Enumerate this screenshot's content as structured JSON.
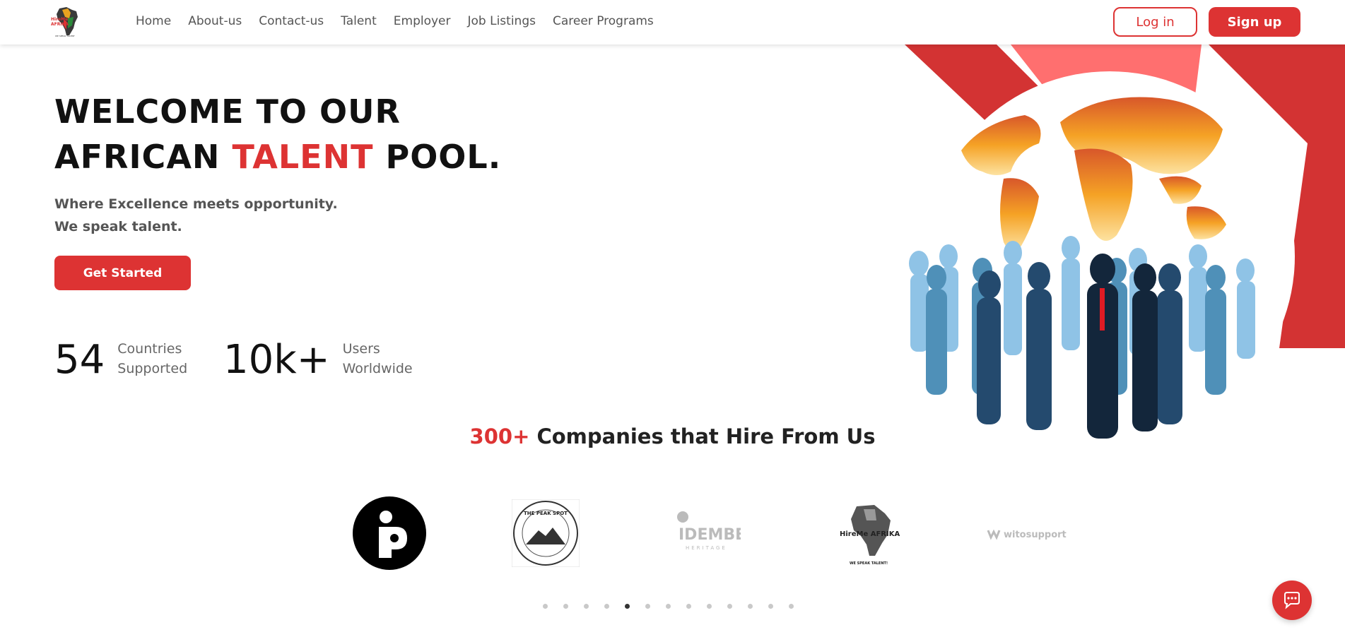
{
  "brand": {
    "logo_text": "HireMe AFRIKA",
    "logo_tagline": "WE SPEAK TALENT"
  },
  "nav": {
    "items": [
      "Home",
      "About-us",
      "Contact-us",
      "Talent",
      "Employer",
      "Job Listings",
      "Career Programs"
    ]
  },
  "auth": {
    "login_label": "Log in",
    "signup_label": "Sign up"
  },
  "hero": {
    "title_line1": "WELCOME TO OUR",
    "title_line2_part1": "AFRICAN ",
    "title_line2_accent": "TALENT",
    "title_line2_part2": " POOL.",
    "subtitle_line1": "Where Excellence meets opportunity.",
    "subtitle_line2": "We speak talent.",
    "cta_label": "Get Started"
  },
  "stats": [
    {
      "value": "54",
      "label_line1": "Countries",
      "label_line2": "Supported"
    },
    {
      "value": "10k+",
      "label_line1": "Users",
      "label_line2": "Worldwide"
    }
  ],
  "companies": {
    "count": "300+",
    "title": " Companies that Hire From Us",
    "logos": [
      {
        "name": "i-logo"
      },
      {
        "name": "the-peak-spot-logo",
        "text": "THE PEAK SPOT"
      },
      {
        "name": "idembe-heritage-logo",
        "text": "IDEMBE",
        "sub": "HERITAGE"
      },
      {
        "name": "hireme-afrika-logo",
        "text": "HireMe AFRIKA",
        "sub": "WE SPEAK TALENT!"
      },
      {
        "name": "witosupport-logo",
        "text": "witosupport"
      }
    ]
  },
  "carousel": {
    "dot_count": 13,
    "active_index": 4
  },
  "colors": {
    "accent": "#d33333",
    "accent_light": "#ff6f6f",
    "text_dark": "#111111",
    "text_muted": "#555555"
  },
  "chat": {
    "icon": "chat-bubble-icon"
  }
}
